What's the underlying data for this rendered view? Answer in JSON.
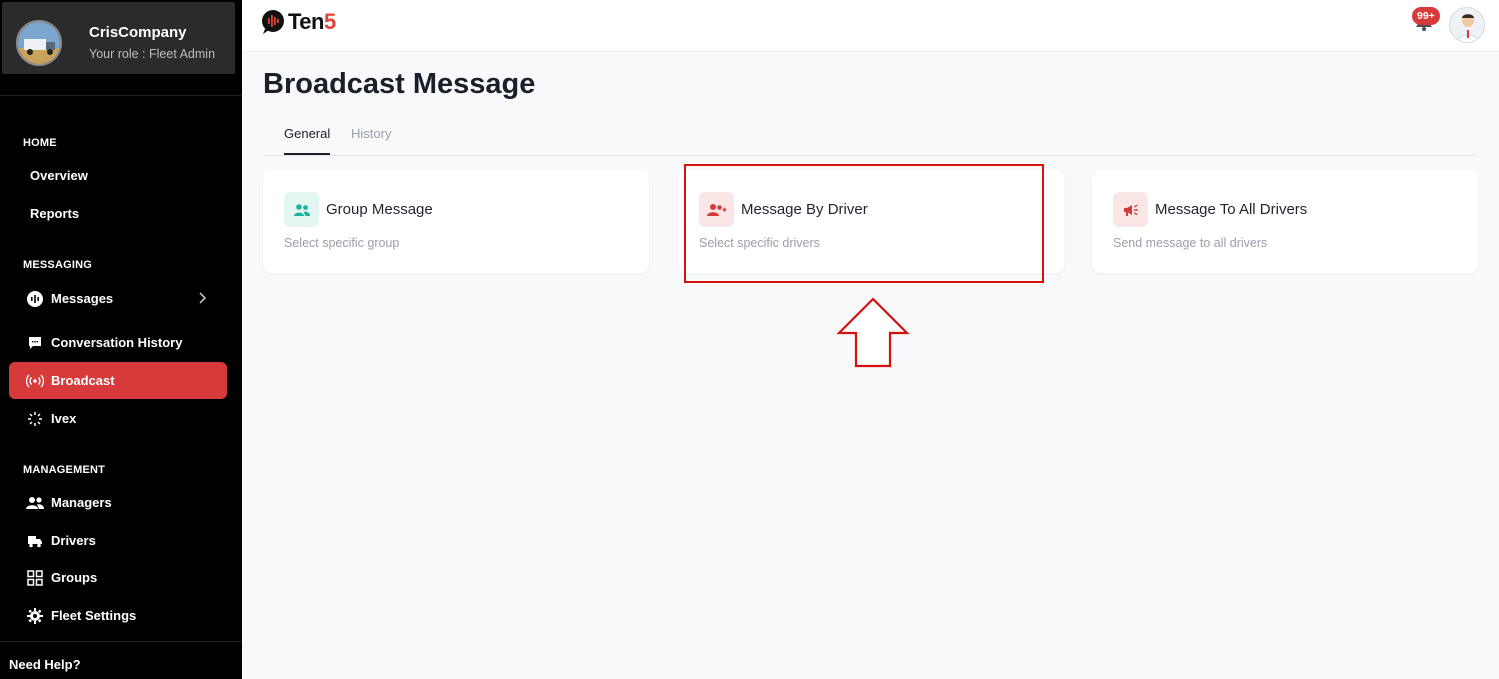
{
  "sidebar": {
    "company_name": "CrisCompany",
    "role_label": "Your role :",
    "role_value": "Fleet Admin",
    "sections": {
      "home": "HOME",
      "messaging": "MESSAGING",
      "management": "MANAGEMENT"
    },
    "items": [
      {
        "label": "Overview",
        "icon": "none"
      },
      {
        "label": "Reports",
        "icon": "none"
      },
      {
        "label": "Messages",
        "icon": "messages-icon"
      },
      {
        "label": "Conversation History",
        "icon": "chat-bubble-icon"
      },
      {
        "label": "Broadcast",
        "icon": "broadcast-icon"
      },
      {
        "label": "Ivex",
        "icon": "spinner-icon"
      },
      {
        "label": "Managers",
        "icon": "people-icon"
      },
      {
        "label": "Drivers",
        "icon": "truck-icon"
      },
      {
        "label": "Groups",
        "icon": "grid-icon"
      },
      {
        "label": "Fleet Settings",
        "icon": "gear-icon"
      }
    ],
    "need_help": "Need Help?"
  },
  "header": {
    "logo_text_a": "Ten",
    "logo_text_b": "5",
    "notification_badge": "99+"
  },
  "main": {
    "title": "Broadcast Message",
    "tabs": [
      {
        "label": "General",
        "active": true
      },
      {
        "label": "History",
        "active": false
      }
    ],
    "cards": [
      {
        "title": "Group Message",
        "subtitle": "Select specific group",
        "icon": "group-icon"
      },
      {
        "title": "Message By Driver",
        "subtitle": "Select specific drivers",
        "icon": "user-plus-icon"
      },
      {
        "title": "Message To All Drivers",
        "subtitle": "Send message to all drivers",
        "icon": "megaphone-icon"
      }
    ]
  },
  "colors": {
    "accent": "#d63a3a",
    "sidebar_bg": "#000000",
    "teal_icon": "#20b2a0",
    "red_icon": "#d63a3a"
  }
}
